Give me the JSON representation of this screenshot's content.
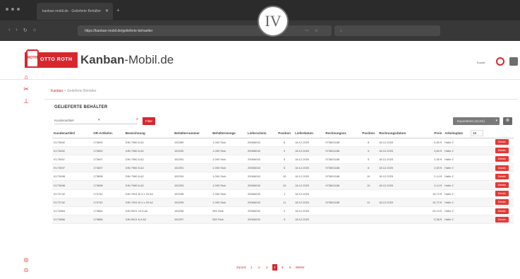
{
  "overlay": {
    "badge": "IV"
  },
  "browser": {
    "tab_title": "kanban-mobil.de · Gelieferte Behälter",
    "url": "https://kanban-mobil.de/gelieferte-behaelter"
  },
  "header": {
    "brand_box": "OTTO ROTH",
    "emblem": "ROTH",
    "brand_kanban": "Kanban",
    "brand_mobil": "-Mobil.de",
    "user_label": "Kunde"
  },
  "breadcrumb": {
    "root": "Kanban",
    "sep": " > ",
    "current": "Gelieferte Behälter"
  },
  "panel": {
    "title": "GELIEFERTE BEHÄLTER",
    "filter_field": "Kundenartikel",
    "filter_button": "Filter",
    "export_button": "Exportieren (XLSX)",
    "page_size": "10"
  },
  "table": {
    "headers": [
      "Kundenartikel",
      "OR-Artikelnr.",
      "Bezeichnung",
      "Behälternummer",
      "Behältermenge",
      "Lieferschein",
      "Position",
      "Lieferdatum",
      "Rechnungsnr.",
      "Position",
      "Rechnungsdatum",
      "Preis",
      "Arbeitsplatz",
      "",
      ""
    ],
    "details_label": "Details",
    "rows": [
      [
        "K173692",
        "173692",
        "DIN 7980 8 A2",
        "152289",
        "1.000 Stck",
        "20066018",
        "8",
        "18.12.2020",
        "973601188",
        "8",
        "18.12.2020",
        "0,80 €",
        "Halle 2"
      ],
      [
        "K173692",
        "173692",
        "DIN 7980 8 A2",
        "152290",
        "1.000 Stck",
        "20066018",
        "9",
        "18.12.2020",
        "973601188",
        "9",
        "18.12.2020",
        "0,80 €",
        "Halle 2"
      ],
      [
        "K173697",
        "173697",
        "DIN 7980 5 A2",
        "152292",
        "1.000 Stck",
        "20066018",
        "5",
        "18.12.2020",
        "973601188",
        "5",
        "18.12.2020",
        "2,50 €",
        "Halle 2"
      ],
      [
        "K173697",
        "173697",
        "DIN 7980 5 A2",
        "152291",
        "1.000 Stck",
        "20066018",
        "6",
        "18.12.2020",
        "973601188",
        "6",
        "18.12.2020",
        "2,50 €",
        "Halle 2"
      ],
      [
        "K173698",
        "173698",
        "DIN 7980 6 A2",
        "152294",
        "1.000 Stck",
        "20066018",
        "10",
        "18.12.2020",
        "973601188",
        "10",
        "18.12.2020",
        "2,14 €",
        "Halle 2"
      ],
      [
        "K173698",
        "173698",
        "DIN 7980 6 A2",
        "152293",
        "1.000 Stck",
        "20066018",
        "10",
        "18.12.2020",
        "973601188",
        "10",
        "18.12.2020",
        "2,14 €",
        "Halle 2"
      ],
      [
        "K173742",
        "173742",
        "DIN 7991 M 4 x 20 A2",
        "152298",
        "1.000 Stck",
        "20066026",
        "1",
        "18.12.2020",
        "",
        "",
        "",
        "10,72 €",
        "Halle 2"
      ],
      [
        "K173742",
        "173742",
        "DIN 7991 M 4 x 20 A2",
        "152299",
        "1.000 Stck",
        "20066018",
        "11",
        "18.12.2020",
        "973601188",
        "11",
        "18.12.2020",
        "10,72 €",
        "Halle 2"
      ],
      [
        "K173864",
        "173864",
        "DIN 9021 10,5 A2",
        "152296",
        "500 Stck",
        "20066026",
        "2",
        "18.12.2020",
        "",
        "",
        "",
        "20,13 €",
        "Halle 2"
      ],
      [
        "K173866",
        "173866",
        "DIN 9021 6,4 A2",
        "152297",
        "500 Stck",
        "20066026",
        "3",
        "18.12.2020",
        "",
        "",
        "",
        "0,36 €",
        "Halle 2"
      ]
    ]
  },
  "pagination": {
    "prev": "Zurück",
    "pages": [
      "1",
      "2",
      "3",
      "4",
      "5",
      "6"
    ],
    "active": "4",
    "next": "Weiter"
  }
}
